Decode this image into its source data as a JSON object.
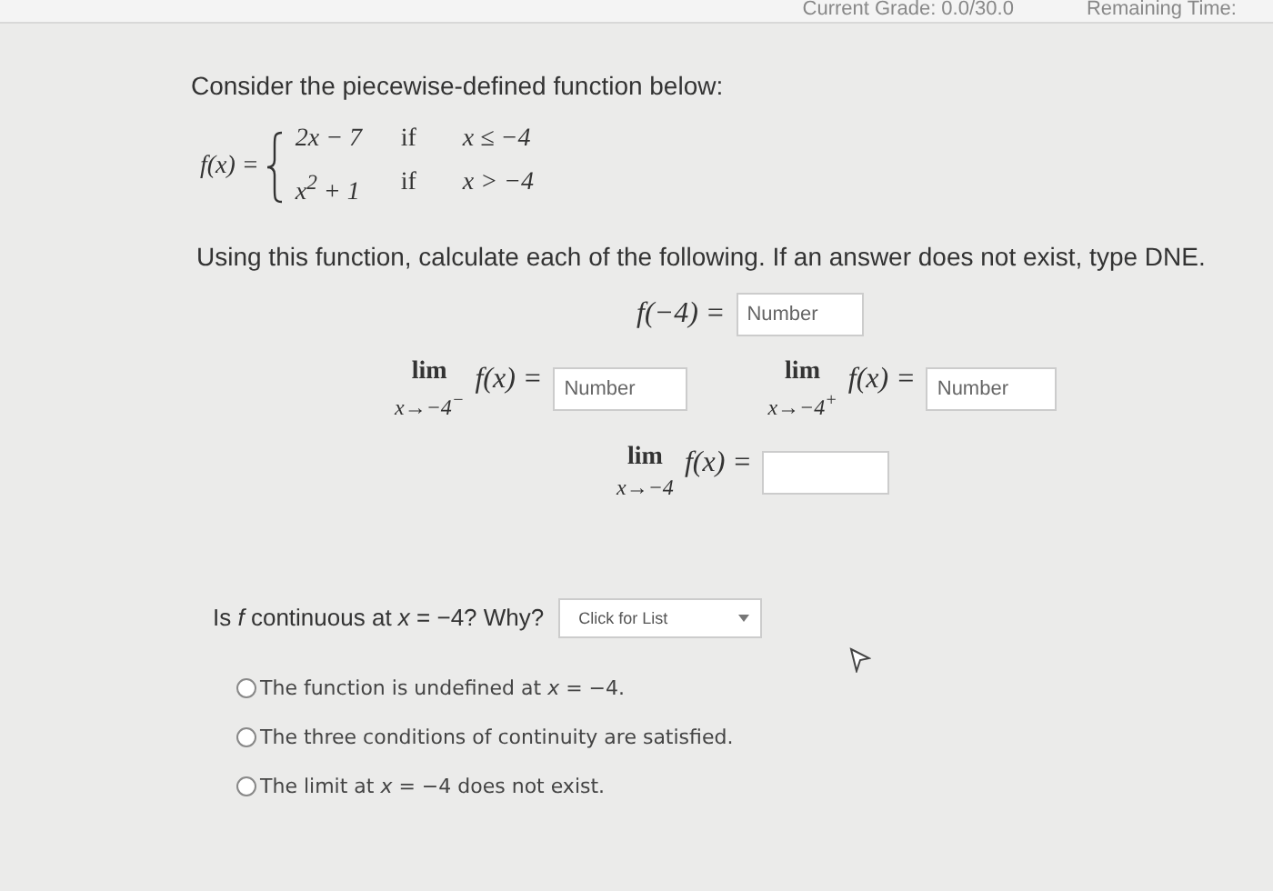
{
  "header": {
    "grade": "Current Grade: 0.0/30.0",
    "time": "Remaining Time:"
  },
  "intro": "Consider the piecewise-defined function below:",
  "function": {
    "lhs": "f(x) =",
    "pieces": [
      {
        "expr": "2x − 7",
        "cond": "if",
        "rel": "x ≤ −4"
      },
      {
        "expr": "x$^{2}$ + 1",
        "cond": "if",
        "rel": "x > −4"
      }
    ]
  },
  "instructions": "Using this function, calculate each of the following. If an answer does not exist, type DNE.",
  "value_question": {
    "label": "f(−4) =",
    "placeholder": "Number"
  },
  "limits": [
    {
      "lim": "lim",
      "sub": "x→−4$^{−}$",
      "label": "f(x) =",
      "placeholder": "Number"
    },
    {
      "lim": "lim",
      "sub": "x→−4$^{+}$",
      "label": "f(x) =",
      "placeholder": "Number"
    },
    {
      "lim": "lim",
      "sub": "x→−4",
      "label": "f(x) ="
    }
  ],
  "continuity": {
    "question": "Is *f* continuous at *x* = −4? Why?",
    "dropdown": "Click for List",
    "options": [
      {
        "text": "The function is undefined at *x* = −4.",
        "selected": false
      },
      {
        "text": "The three conditions of continuity are satisfied.",
        "selected": false
      },
      {
        "text": "The limit at *x* = −4 does not exist.",
        "selected": false
      }
    ]
  }
}
